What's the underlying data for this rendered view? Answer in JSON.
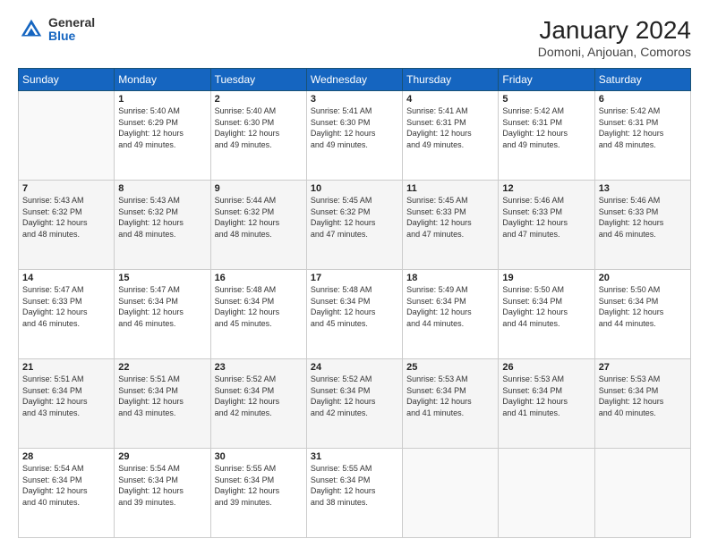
{
  "header": {
    "logo_general": "General",
    "logo_blue": "Blue",
    "title": "January 2024",
    "subtitle": "Domoni, Anjouan, Comoros"
  },
  "weekdays": [
    "Sunday",
    "Monday",
    "Tuesday",
    "Wednesday",
    "Thursday",
    "Friday",
    "Saturday"
  ],
  "weeks": [
    [
      {
        "day": "",
        "info": ""
      },
      {
        "day": "1",
        "info": "Sunrise: 5:40 AM\nSunset: 6:29 PM\nDaylight: 12 hours\nand 49 minutes."
      },
      {
        "day": "2",
        "info": "Sunrise: 5:40 AM\nSunset: 6:30 PM\nDaylight: 12 hours\nand 49 minutes."
      },
      {
        "day": "3",
        "info": "Sunrise: 5:41 AM\nSunset: 6:30 PM\nDaylight: 12 hours\nand 49 minutes."
      },
      {
        "day": "4",
        "info": "Sunrise: 5:41 AM\nSunset: 6:31 PM\nDaylight: 12 hours\nand 49 minutes."
      },
      {
        "day": "5",
        "info": "Sunrise: 5:42 AM\nSunset: 6:31 PM\nDaylight: 12 hours\nand 49 minutes."
      },
      {
        "day": "6",
        "info": "Sunrise: 5:42 AM\nSunset: 6:31 PM\nDaylight: 12 hours\nand 48 minutes."
      }
    ],
    [
      {
        "day": "7",
        "info": "Sunrise: 5:43 AM\nSunset: 6:32 PM\nDaylight: 12 hours\nand 48 minutes."
      },
      {
        "day": "8",
        "info": "Sunrise: 5:43 AM\nSunset: 6:32 PM\nDaylight: 12 hours\nand 48 minutes."
      },
      {
        "day": "9",
        "info": "Sunrise: 5:44 AM\nSunset: 6:32 PM\nDaylight: 12 hours\nand 48 minutes."
      },
      {
        "day": "10",
        "info": "Sunrise: 5:45 AM\nSunset: 6:32 PM\nDaylight: 12 hours\nand 47 minutes."
      },
      {
        "day": "11",
        "info": "Sunrise: 5:45 AM\nSunset: 6:33 PM\nDaylight: 12 hours\nand 47 minutes."
      },
      {
        "day": "12",
        "info": "Sunrise: 5:46 AM\nSunset: 6:33 PM\nDaylight: 12 hours\nand 47 minutes."
      },
      {
        "day": "13",
        "info": "Sunrise: 5:46 AM\nSunset: 6:33 PM\nDaylight: 12 hours\nand 46 minutes."
      }
    ],
    [
      {
        "day": "14",
        "info": "Sunrise: 5:47 AM\nSunset: 6:33 PM\nDaylight: 12 hours\nand 46 minutes."
      },
      {
        "day": "15",
        "info": "Sunrise: 5:47 AM\nSunset: 6:34 PM\nDaylight: 12 hours\nand 46 minutes."
      },
      {
        "day": "16",
        "info": "Sunrise: 5:48 AM\nSunset: 6:34 PM\nDaylight: 12 hours\nand 45 minutes."
      },
      {
        "day": "17",
        "info": "Sunrise: 5:48 AM\nSunset: 6:34 PM\nDaylight: 12 hours\nand 45 minutes."
      },
      {
        "day": "18",
        "info": "Sunrise: 5:49 AM\nSunset: 6:34 PM\nDaylight: 12 hours\nand 44 minutes."
      },
      {
        "day": "19",
        "info": "Sunrise: 5:50 AM\nSunset: 6:34 PM\nDaylight: 12 hours\nand 44 minutes."
      },
      {
        "day": "20",
        "info": "Sunrise: 5:50 AM\nSunset: 6:34 PM\nDaylight: 12 hours\nand 44 minutes."
      }
    ],
    [
      {
        "day": "21",
        "info": "Sunrise: 5:51 AM\nSunset: 6:34 PM\nDaylight: 12 hours\nand 43 minutes."
      },
      {
        "day": "22",
        "info": "Sunrise: 5:51 AM\nSunset: 6:34 PM\nDaylight: 12 hours\nand 43 minutes."
      },
      {
        "day": "23",
        "info": "Sunrise: 5:52 AM\nSunset: 6:34 PM\nDaylight: 12 hours\nand 42 minutes."
      },
      {
        "day": "24",
        "info": "Sunrise: 5:52 AM\nSunset: 6:34 PM\nDaylight: 12 hours\nand 42 minutes."
      },
      {
        "day": "25",
        "info": "Sunrise: 5:53 AM\nSunset: 6:34 PM\nDaylight: 12 hours\nand 41 minutes."
      },
      {
        "day": "26",
        "info": "Sunrise: 5:53 AM\nSunset: 6:34 PM\nDaylight: 12 hours\nand 41 minutes."
      },
      {
        "day": "27",
        "info": "Sunrise: 5:53 AM\nSunset: 6:34 PM\nDaylight: 12 hours\nand 40 minutes."
      }
    ],
    [
      {
        "day": "28",
        "info": "Sunrise: 5:54 AM\nSunset: 6:34 PM\nDaylight: 12 hours\nand 40 minutes."
      },
      {
        "day": "29",
        "info": "Sunrise: 5:54 AM\nSunset: 6:34 PM\nDaylight: 12 hours\nand 39 minutes."
      },
      {
        "day": "30",
        "info": "Sunrise: 5:55 AM\nSunset: 6:34 PM\nDaylight: 12 hours\nand 39 minutes."
      },
      {
        "day": "31",
        "info": "Sunrise: 5:55 AM\nSunset: 6:34 PM\nDaylight: 12 hours\nand 38 minutes."
      },
      {
        "day": "",
        "info": ""
      },
      {
        "day": "",
        "info": ""
      },
      {
        "day": "",
        "info": ""
      }
    ]
  ]
}
